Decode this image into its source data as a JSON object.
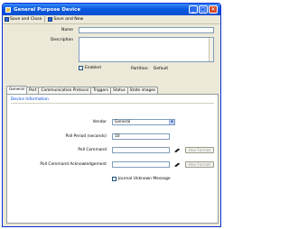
{
  "window": {
    "title": "General Purpose Device"
  },
  "toolbar": {
    "save_close": "Save and Close",
    "save_new": "Save and New"
  },
  "form": {
    "name_label": "Name",
    "name_value": "",
    "description_label": "Description",
    "description_value": "",
    "enabled_label": "Enabled",
    "partition_label": "Partition:",
    "partition_value": "Default"
  },
  "tabs": [
    {
      "label": "General",
      "active": true
    },
    {
      "label": "Port"
    },
    {
      "label": "Communication Protocol"
    },
    {
      "label": "Triggers"
    },
    {
      "label": "Status"
    },
    {
      "label": "State images"
    }
  ],
  "device_info": {
    "group_title": "Device Information",
    "vendor_label": "Vendor",
    "vendor_value": "General",
    "poll_period_label": "Poll Period (seconds)",
    "poll_period_value": "10",
    "poll_command_label": "Poll Command",
    "poll_command_value": "",
    "poll_ack_label": "Poll Command Acknowledgement",
    "poll_ack_value": "",
    "hex_format_label": "Hex Format",
    "journal_label": "Journal Unknown Message"
  },
  "colors": {
    "titlebar": "#0a58e0",
    "group_title": "#0046d5"
  }
}
